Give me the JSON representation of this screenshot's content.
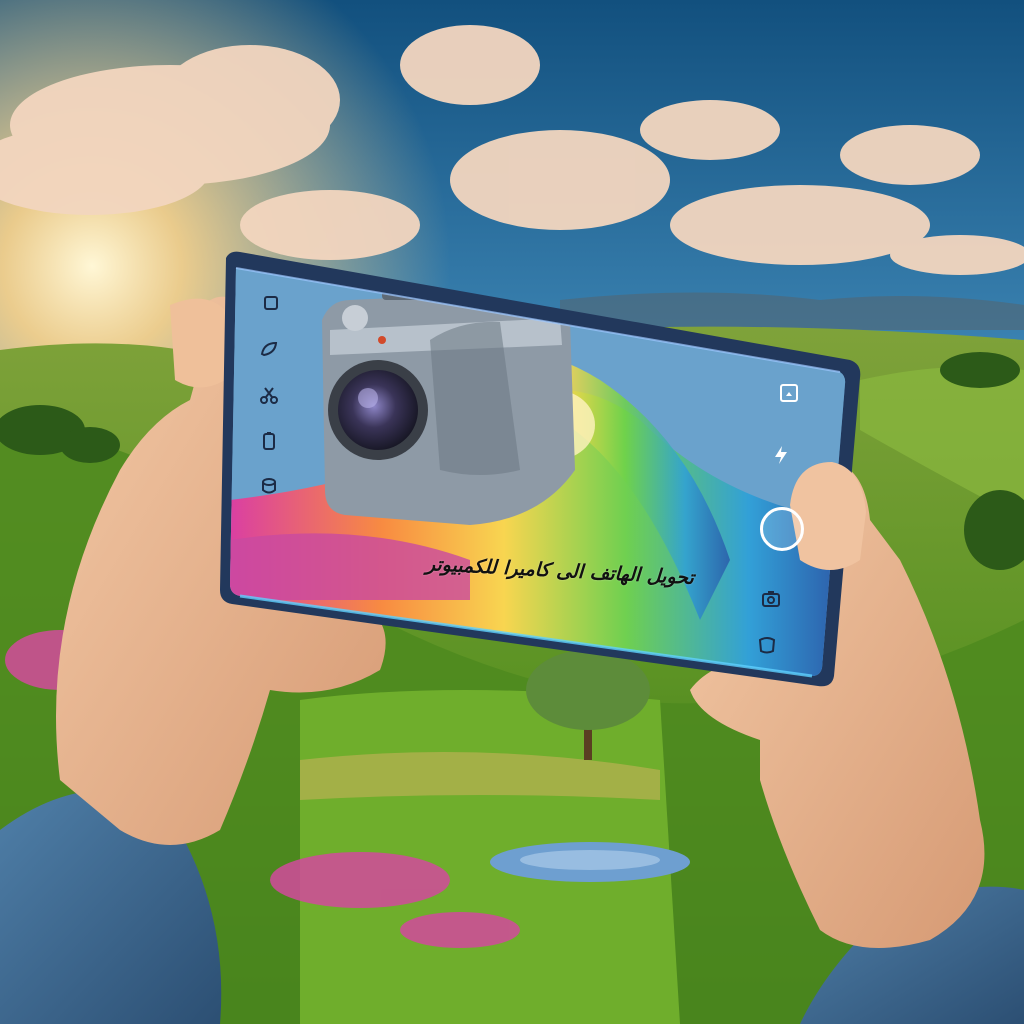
{
  "image": {
    "caption_text": "تحويل الهاتف الى كاميرا للكمبيوتر"
  },
  "phone_ui": {
    "left_icons": [
      "square-icon",
      "leaf-icon",
      "scissors-icon",
      "battery-icon",
      "cylinder-icon"
    ],
    "right_icons": [
      "frame-icon",
      "flash-icon",
      "shutter-button",
      "camera-switch-icon",
      "gallery-icon"
    ]
  },
  "colors": {
    "sky_top": "#1b5a8a",
    "sun_glow": "#ffd58a",
    "grass": "#5f9b2a",
    "phone_bezel": "#2a3f66",
    "camera_metal": "#9aa6b2"
  }
}
